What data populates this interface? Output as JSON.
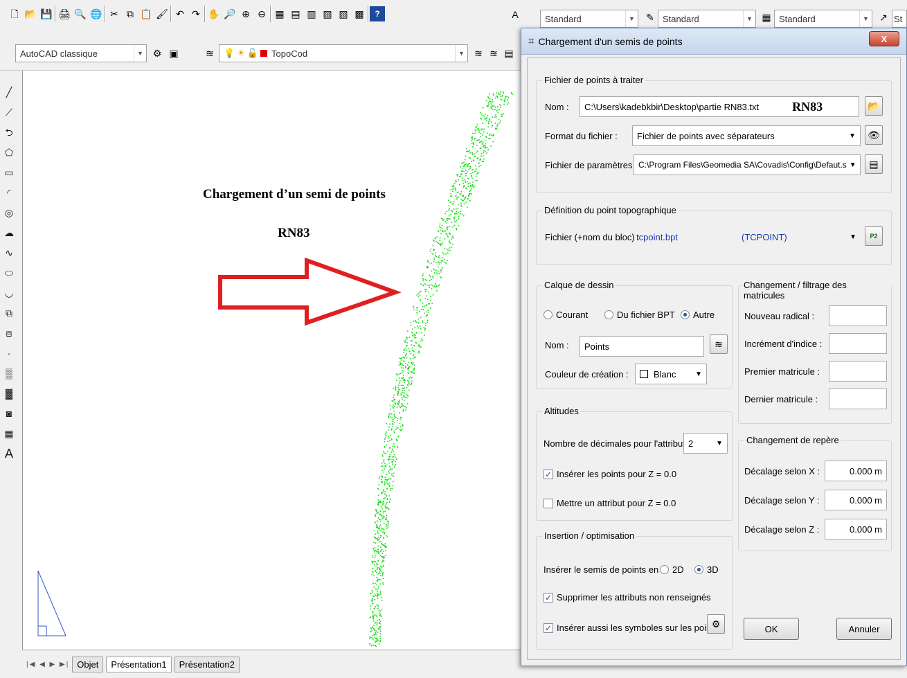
{
  "toolbar": {
    "workspace": "AutoCAD classique",
    "layer": "TopoCod",
    "style1": "Standard",
    "style2": "Standard",
    "style3": "Standard",
    "style4": "St"
  },
  "canvas": {
    "annotation_title": "Chargement d’un semi de points",
    "annotation_sub": "RN83",
    "arrow_color": "#e02020",
    "points_color": "#11dd11"
  },
  "tabs": [
    "Objet",
    "Présentation1",
    "Présentation2"
  ],
  "dialog": {
    "title": "Chargement d'un semis de points",
    "close": "X",
    "grp_file": {
      "title": "Fichier de points à traiter",
      "nom_label": "Nom :",
      "nom_value": "C:\\Users\\kadebkbir\\Desktop\\partie RN83.txt",
      "nom_overlay": "RN83",
      "format_label": "Format du fichier :",
      "format_value": "Fichier de points avec séparateurs",
      "params_label": "Fichier de paramètres :",
      "params_value": "C:\\Program Files\\Geomedia SA\\Covadis\\Config\\Defaut.s"
    },
    "grp_point": {
      "title": "Définition du point topographique",
      "fichier_label": "Fichier (+nom du bloc) :",
      "fichier_value": "tcpoint.bpt",
      "block_value": "(TCPOINT)"
    },
    "grp_calque": {
      "title": "Calque de dessin",
      "radio1": "Courant",
      "radio2": "Du fichier BPT",
      "radio3": "Autre",
      "nom_label": "Nom :",
      "nom_value": "Points",
      "couleur_label": "Couleur de création :",
      "couleur_value": "Blanc"
    },
    "grp_matricules": {
      "title": "Changement / filtrage des matricules",
      "radical": "Nouveau radical :",
      "increment": "Incrément d'indice :",
      "premier": "Premier matricule :",
      "dernier": "Dernier matricule :"
    },
    "grp_altitudes": {
      "title": "Altitudes",
      "decimales_label": "Nombre de décimales pour l'attribut :",
      "decimales_value": "2",
      "chk1": "Insérer les points pour Z = 0.0",
      "chk2": "Mettre un attribut pour Z = 0.0"
    },
    "grp_repere": {
      "title": "Changement de repère",
      "x_label": "Décalage selon X :",
      "x_value": "0.000 m",
      "y_label": "Décalage selon Y :",
      "y_value": "0.000 m",
      "z_label": "Décalage selon Z :",
      "z_value": "0.000 m"
    },
    "grp_insertion": {
      "title": "Insertion / optimisation",
      "inserer_label": "Insérer le semis de points en :",
      "opt2d": "2D",
      "opt3d": "3D",
      "chk1": "Supprimer les attributs non renseignés",
      "chk2": "Insérer aussi les symboles sur les points"
    },
    "ok": "OK",
    "cancel": "Annuler"
  }
}
